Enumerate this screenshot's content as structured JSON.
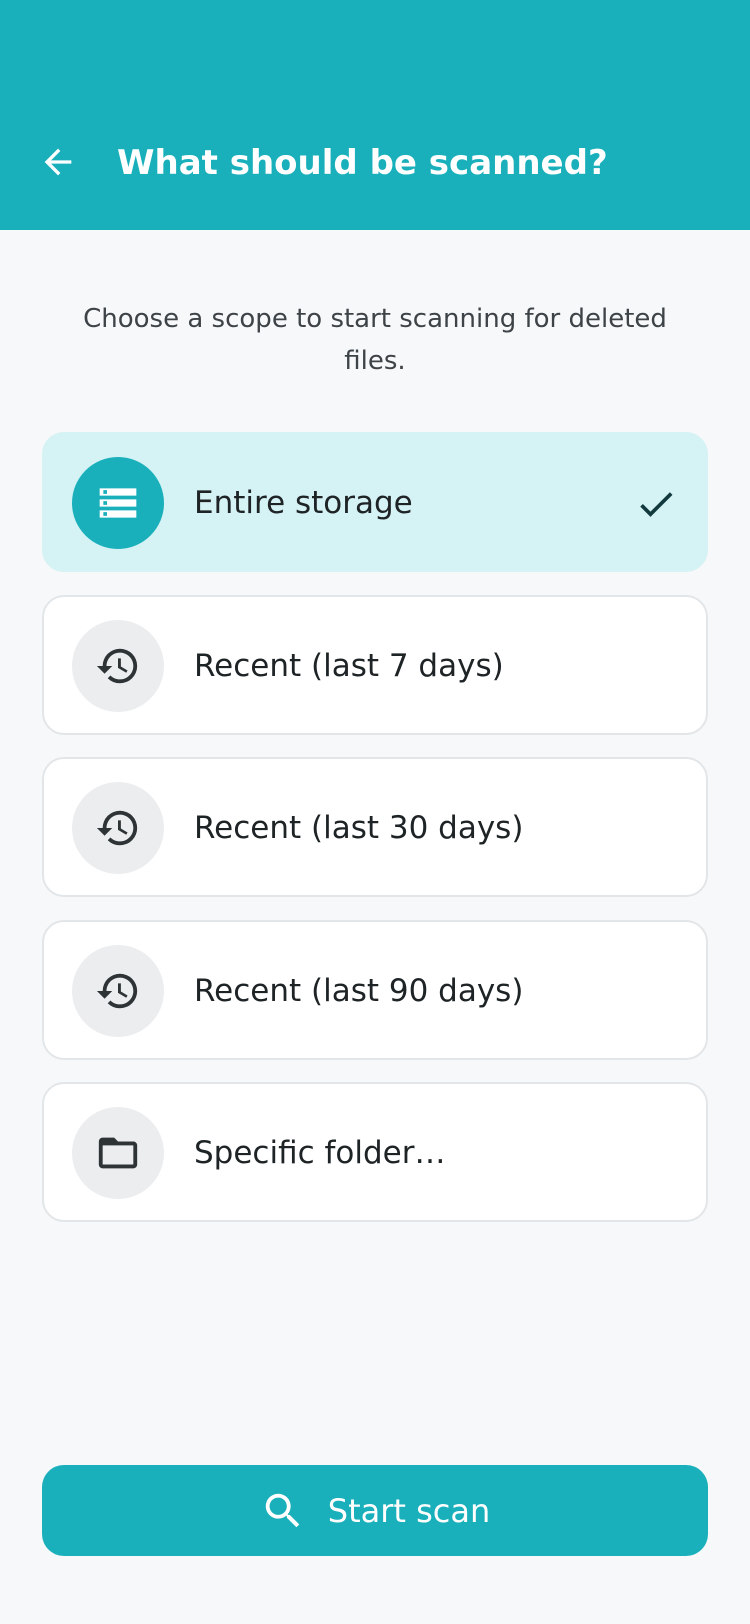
{
  "header": {
    "title": "What should be scanned?",
    "back_icon": "arrow-left-icon",
    "background_color": "#1ab0bb"
  },
  "intro_text": "Choose a scope to start scanning for deleted files.",
  "options": [
    {
      "label": "Entire storage",
      "icon": "storage-icon",
      "selected": true
    },
    {
      "label": "Recent (last 7 days)",
      "icon": "history-icon",
      "selected": false
    },
    {
      "label": "Recent (last 30 days)",
      "icon": "history-icon",
      "selected": false
    },
    {
      "label": "Recent (last 90 days)",
      "icon": "history-icon",
      "selected": false
    },
    {
      "label": "Specific folder…",
      "icon": "folder-icon",
      "selected": false
    }
  ],
  "selected_indicator_icon": "checkmark-icon",
  "scan_button": {
    "label": "Start scan",
    "icon": "search-icon"
  },
  "colors": {
    "accent": "#1ab0bb",
    "selected_background": "#d5f2f4",
    "page_background": "#f7f8fa"
  }
}
